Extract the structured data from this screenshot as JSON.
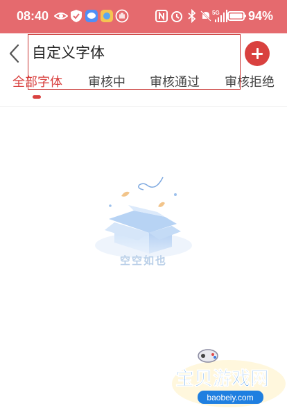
{
  "status_bar": {
    "time": "08:40",
    "battery": "94%",
    "icons": [
      "eye-icon",
      "shield-icon",
      "message-icon",
      "photo-icon",
      "hand-icon",
      "nfc-icon",
      "alarm-icon",
      "bluetooth-icon",
      "mute-icon",
      "signal-5g-icon",
      "battery-icon"
    ]
  },
  "header": {
    "title": "自定义字体",
    "back_icon": "chevron-left-icon",
    "add_icon": "plus-icon",
    "accent_color": "#d9413f"
  },
  "tabs": [
    {
      "label": "全部字体",
      "active": true
    },
    {
      "label": "审核中",
      "active": false
    },
    {
      "label": "审核通过",
      "active": false
    },
    {
      "label": "审核拒绝",
      "active": false
    }
  ],
  "empty_state": {
    "text": "空空如也"
  },
  "watermark": {
    "title": "宝贝游戏网",
    "url": "baobeiy.com"
  }
}
